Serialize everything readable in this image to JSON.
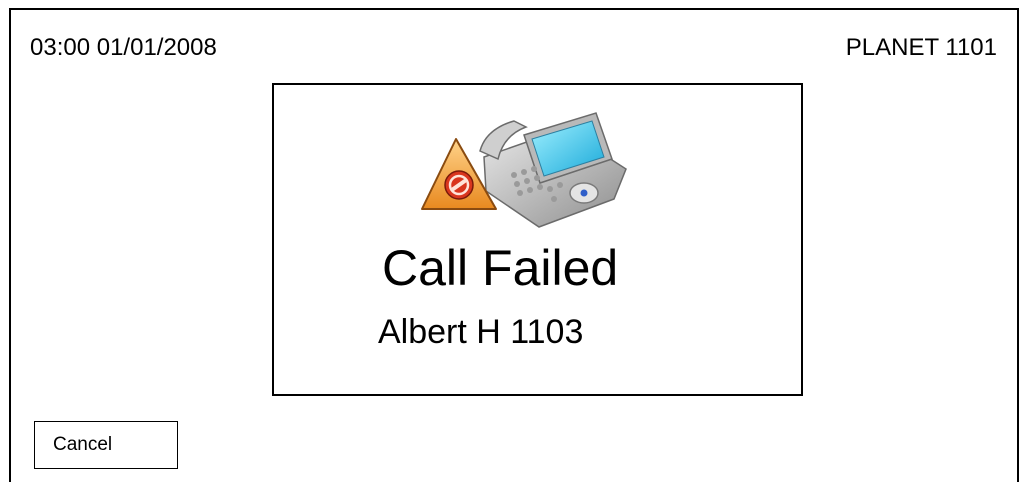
{
  "status_bar": {
    "datetime": "03:00 01/01/2008",
    "extension_label": "PLANET 1101"
  },
  "dialog": {
    "icon": "phone-call-failed-warning-icon",
    "title": "Call Failed",
    "subtitle": "Albert H 1103"
  },
  "actions": {
    "cancel_label": "Cancel"
  },
  "colors": {
    "border": "#000000",
    "background": "#ffffff",
    "warning_orange": "#f2a23a",
    "stop_red": "#d9361e",
    "screen_cyan": "#3fc7ee"
  }
}
